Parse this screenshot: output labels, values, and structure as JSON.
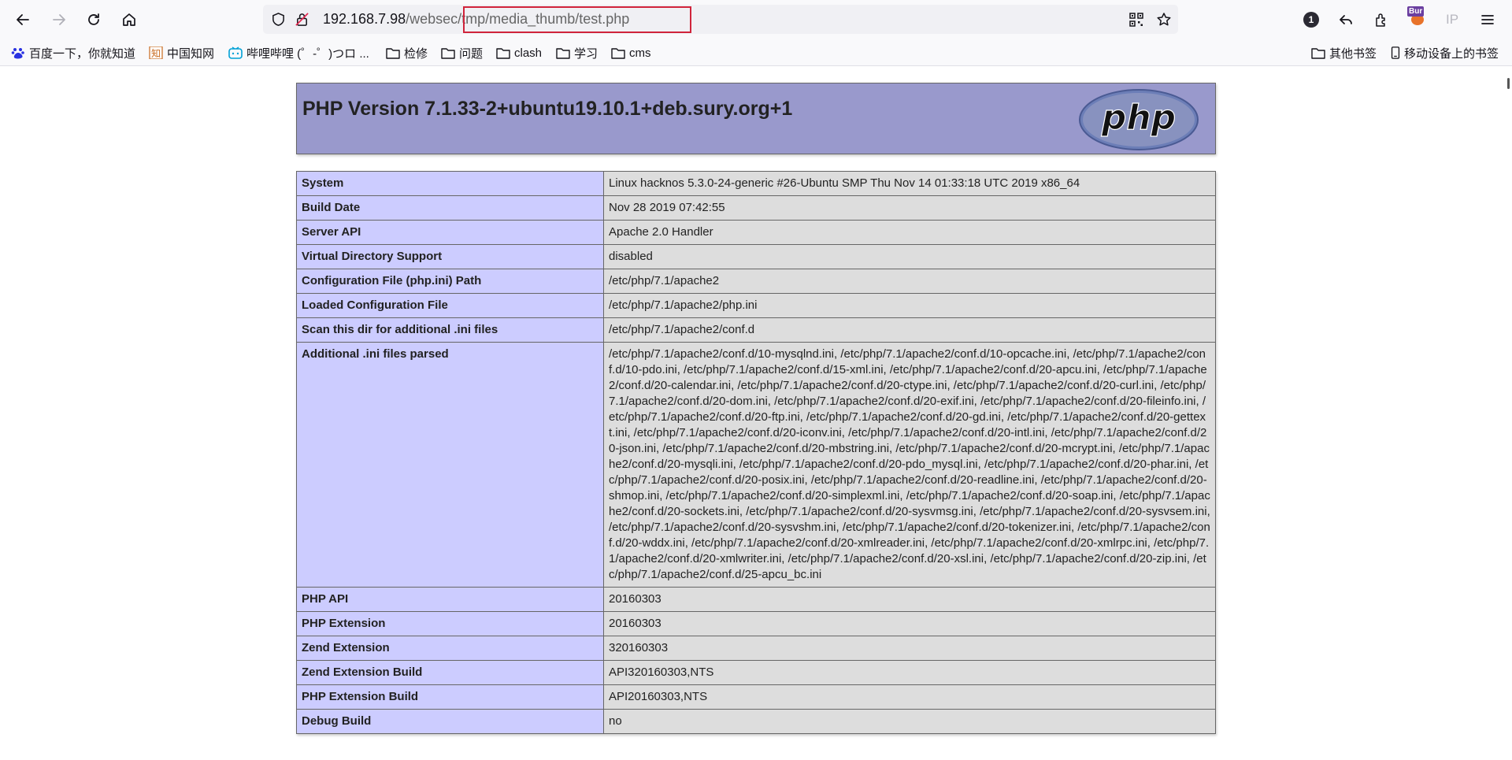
{
  "browser": {
    "url_host": "192.168.7.98",
    "url_path": "/websec/tmp/media_thumb/test.php",
    "notification_count": "1",
    "ip_label": "IP",
    "burp_badge": "Bur"
  },
  "bookmarks": {
    "left": [
      {
        "label": "百度一下，你就知道",
        "icon": "baidu-icon"
      },
      {
        "label": "中国知网",
        "icon": "cnki-icon"
      },
      {
        "label": "哔哩哔哩 (゜-゜)つロ ...",
        "icon": "bilibili-icon"
      },
      {
        "label": "检修",
        "icon": "folder-icon"
      },
      {
        "label": "问题",
        "icon": "folder-icon"
      },
      {
        "label": "clash",
        "icon": "folder-icon"
      },
      {
        "label": "学习",
        "icon": "folder-icon"
      },
      {
        "label": "cms",
        "icon": "folder-icon"
      }
    ],
    "right": [
      {
        "label": "其他书签",
        "icon": "folder-icon"
      },
      {
        "label": "移动设备上的书签",
        "icon": "mobile-icon"
      }
    ]
  },
  "phpinfo": {
    "title": "PHP Version 7.1.33-2+ubuntu19.10.1+deb.sury.org+1",
    "logo_text": "php",
    "rows": [
      {
        "key": "System",
        "value": "Linux hacknos 5.3.0-24-generic #26-Ubuntu SMP Thu Nov 14 01:33:18 UTC 2019 x86_64"
      },
      {
        "key": "Build Date",
        "value": "Nov 28 2019 07:42:55"
      },
      {
        "key": "Server API",
        "value": "Apache 2.0 Handler"
      },
      {
        "key": "Virtual Directory Support",
        "value": "disabled"
      },
      {
        "key": "Configuration File (php.ini) Path",
        "value": "/etc/php/7.1/apache2"
      },
      {
        "key": "Loaded Configuration File",
        "value": "/etc/php/7.1/apache2/php.ini"
      },
      {
        "key": "Scan this dir for additional .ini files",
        "value": "/etc/php/7.1/apache2/conf.d"
      },
      {
        "key": "Additional .ini files parsed",
        "value": "/etc/php/7.1/apache2/conf.d/10-mysqlnd.ini, /etc/php/7.1/apache2/conf.d/10-opcache.ini, /etc/php/7.1/apache2/conf.d/10-pdo.ini, /etc/php/7.1/apache2/conf.d/15-xml.ini, /etc/php/7.1/apache2/conf.d/20-apcu.ini, /etc/php/7.1/apache2/conf.d/20-calendar.ini, /etc/php/7.1/apache2/conf.d/20-ctype.ini, /etc/php/7.1/apache2/conf.d/20-curl.ini, /etc/php/7.1/apache2/conf.d/20-dom.ini, /etc/php/7.1/apache2/conf.d/20-exif.ini, /etc/php/7.1/apache2/conf.d/20-fileinfo.ini, /etc/php/7.1/apache2/conf.d/20-ftp.ini, /etc/php/7.1/apache2/conf.d/20-gd.ini, /etc/php/7.1/apache2/conf.d/20-gettext.ini, /etc/php/7.1/apache2/conf.d/20-iconv.ini, /etc/php/7.1/apache2/conf.d/20-intl.ini, /etc/php/7.1/apache2/conf.d/20-json.ini, /etc/php/7.1/apache2/conf.d/20-mbstring.ini, /etc/php/7.1/apache2/conf.d/20-mcrypt.ini, /etc/php/7.1/apache2/conf.d/20-mysqli.ini, /etc/php/7.1/apache2/conf.d/20-pdo_mysql.ini, /etc/php/7.1/apache2/conf.d/20-phar.ini, /etc/php/7.1/apache2/conf.d/20-posix.ini, /etc/php/7.1/apache2/conf.d/20-readline.ini, /etc/php/7.1/apache2/conf.d/20-shmop.ini, /etc/php/7.1/apache2/conf.d/20-simplexml.ini, /etc/php/7.1/apache2/conf.d/20-soap.ini, /etc/php/7.1/apache2/conf.d/20-sockets.ini, /etc/php/7.1/apache2/conf.d/20-sysvmsg.ini, /etc/php/7.1/apache2/conf.d/20-sysvsem.ini, /etc/php/7.1/apache2/conf.d/20-sysvshm.ini, /etc/php/7.1/apache2/conf.d/20-tokenizer.ini, /etc/php/7.1/apache2/conf.d/20-wddx.ini, /etc/php/7.1/apache2/conf.d/20-xmlreader.ini, /etc/php/7.1/apache2/conf.d/20-xmlrpc.ini, /etc/php/7.1/apache2/conf.d/20-xmlwriter.ini, /etc/php/7.1/apache2/conf.d/20-xsl.ini, /etc/php/7.1/apache2/conf.d/20-zip.ini, /etc/php/7.1/apache2/conf.d/25-apcu_bc.ini"
      },
      {
        "key": "PHP API",
        "value": "20160303"
      },
      {
        "key": "PHP Extension",
        "value": "20160303"
      },
      {
        "key": "Zend Extension",
        "value": "320160303"
      },
      {
        "key": "Zend Extension Build",
        "value": "API320160303,NTS"
      },
      {
        "key": "PHP Extension Build",
        "value": "API20160303,NTS"
      },
      {
        "key": "Debug Build",
        "value": "no"
      }
    ]
  },
  "colors": {
    "header_bg": "#9999cc",
    "key_bg": "#ccccff",
    "value_bg": "#dddddd",
    "highlight_border": "#d0243b"
  }
}
